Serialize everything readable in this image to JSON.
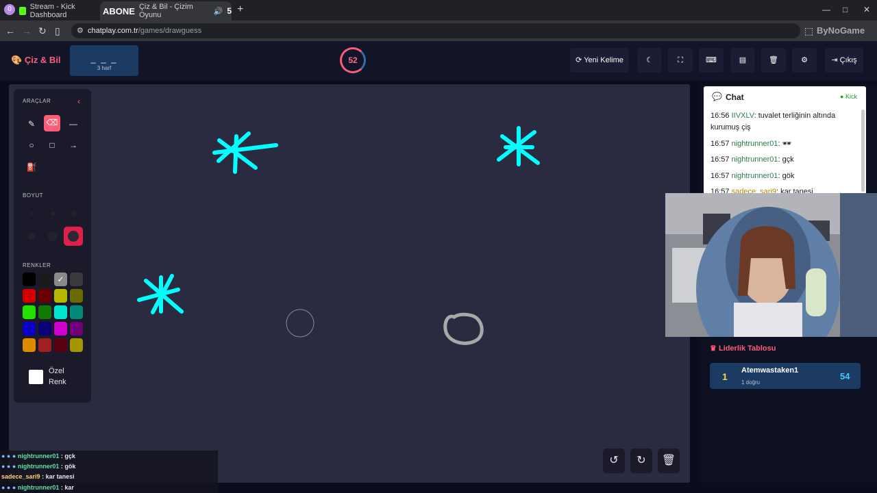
{
  "browser": {
    "profile_badge": "0",
    "tabs": [
      {
        "label": "Stream - Kick Dashboard",
        "favicon_color": "#53fc18"
      },
      {
        "label": "Çiz & Bil - Çizim Oyunu",
        "favicon_color": "#ffffff",
        "overlay_text": "ABONE",
        "count": "5"
      }
    ],
    "new_tab": "+",
    "url_host": "chatplay.com.tr",
    "url_path": "/games/drawguess",
    "extension_text": "ByNoGame"
  },
  "header": {
    "brand": "Çiz & Bil",
    "word_blanks": "_ _ _",
    "word_hint": "3 harf",
    "timer": "52",
    "new_word_label": "Yeni Kelime",
    "exit_label": "Çıkış"
  },
  "toolbox": {
    "tools_label": "ARAÇLAR",
    "size_label": "BOYUT",
    "colors_label": "RENKLER",
    "custom_color_label": "Özel Renk",
    "colors": [
      "#000000",
      "#1b1b1b",
      "#8a8a8a",
      "#3a3a3a",
      "#d40000",
      "#6a0000",
      "#b8b800",
      "#6b6b00",
      "#22e000",
      "#127a00",
      "#00e5d0",
      "#008a7a",
      "#0a00c8",
      "#0a0078",
      "#d000d0",
      "#70007a",
      "#e08a00",
      "#a31e1e",
      "#5a0010",
      "#a39600"
    ]
  },
  "chat": {
    "title": "Chat",
    "platform": "Kick",
    "messages": [
      {
        "time": "16:56",
        "user": "IIVXLV",
        "text": "tuvalet terliğinin altında kurumuş çiş"
      },
      {
        "time": "16:57",
        "user": "nightrunner01",
        "text": "🕶"
      },
      {
        "time": "16:57",
        "user": "nightrunner01",
        "text": "gçk"
      },
      {
        "time": "16:57",
        "user": "nightrunner01",
        "text": "gök"
      },
      {
        "time": "16:57",
        "user": "sadece_sari9",
        "text": "kar tanesi"
      }
    ]
  },
  "leaderboard": {
    "title": "Liderlik Tablosu",
    "rows": [
      {
        "rank": "1",
        "name": "Atemwastaken1",
        "sub": "1 doğru",
        "score": "54"
      }
    ]
  },
  "overlay_chat": [
    {
      "user": "nightrunner01",
      "text": "gçk"
    },
    {
      "user": "nightrunner01",
      "text": "gök"
    },
    {
      "user": "sadece_sari9",
      "text": "kar tanesi"
    },
    {
      "user": "nightrunner01",
      "text": "kar"
    }
  ],
  "colors": {
    "accent": "#ff5c7a",
    "stroke_cyan": "#00ffff",
    "stroke_gray": "#a8a8a8"
  }
}
